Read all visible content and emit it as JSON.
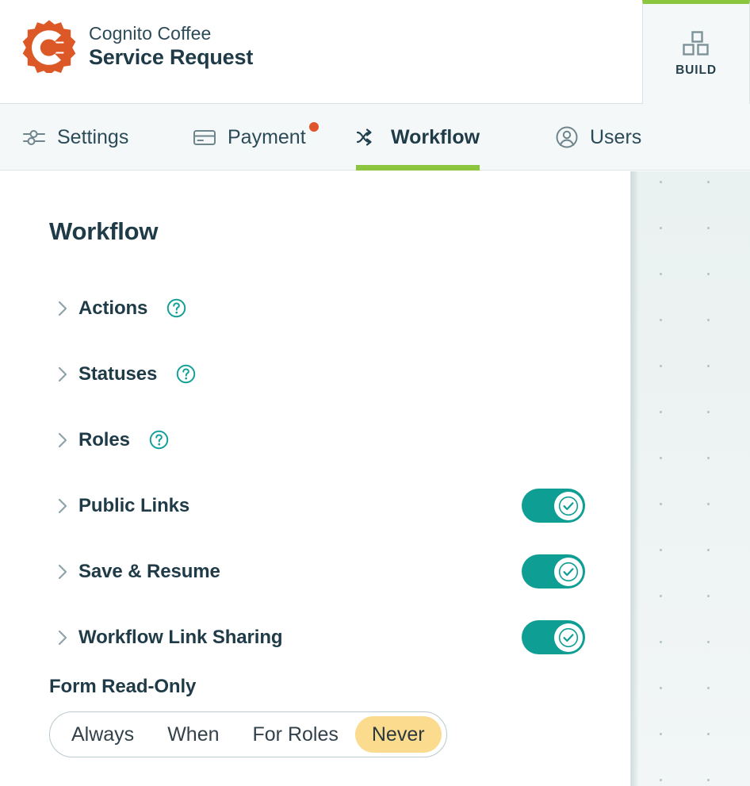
{
  "header": {
    "company": "Cognito Coffee",
    "form_title": "Service Request",
    "logo_icon": "cognito-gear-logo",
    "logo_color": "#DD5827",
    "build": {
      "label": "BUILD",
      "icon": "three-squares-icon",
      "accent_color": "#8CC63E"
    }
  },
  "tabs": [
    {
      "label": "Settings",
      "icon": "sliders-icon",
      "active": false,
      "badge": false
    },
    {
      "label": "Payment",
      "icon": "credit-card-icon",
      "active": false,
      "badge": true,
      "badge_color": "#E0562A"
    },
    {
      "label": "Workflow",
      "icon": "shuffle-icon",
      "active": true,
      "badge": false
    },
    {
      "label": "Users",
      "icon": "user-circle-icon",
      "active": false,
      "badge": false
    }
  ],
  "main": {
    "title": "Workflow",
    "rows": [
      {
        "label": "Actions",
        "help": true,
        "toggle": null
      },
      {
        "label": "Statuses",
        "help": true,
        "toggle": null
      },
      {
        "label": "Roles",
        "help": true,
        "toggle": null
      },
      {
        "label": "Public Links",
        "help": false,
        "toggle": "on"
      },
      {
        "label": "Save & Resume",
        "help": false,
        "toggle": "on"
      },
      {
        "label": "Workflow Link Sharing",
        "help": false,
        "toggle": "on"
      }
    ],
    "read_only": {
      "title": "Form Read-Only",
      "options": [
        "Always",
        "When",
        "For Roles",
        "Never"
      ],
      "selected": "Never",
      "selected_color": "#FBDC8E"
    }
  },
  "canvas": {
    "name": "form-canvas-dot-grid"
  },
  "colors": {
    "brand_orange": "#DD5827",
    "accent_green": "#8CC63E",
    "toggle_teal": "#0F9E94",
    "help_teal": "#14A098",
    "text_dark": "#1F3B47",
    "muted": "#7A8C93"
  }
}
